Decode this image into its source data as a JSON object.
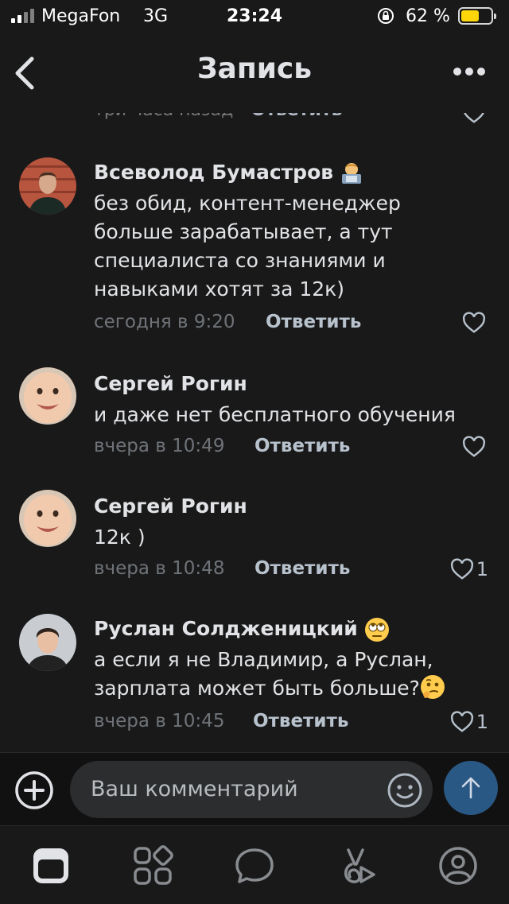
{
  "status_bar": {
    "carrier": "MegaFon",
    "network": "3G",
    "time": "23:24",
    "battery_percent": "62 %",
    "battery_level": 0.62
  },
  "header": {
    "title": "Запись",
    "back_icon": "chevron-left-icon",
    "more_icon": "more-horizontal-icon"
  },
  "previous_comment": {
    "meta": "три часа назад",
    "reply_label": "Ответить"
  },
  "comments": [
    {
      "author": "Всеволод Бумастров",
      "author_emoji": "technologist-emoji",
      "text": "без обид, контент-менеджер больше зарабатывает, а тут специалиста со знаниями и навыками хотят за 12к)",
      "time": "сегодня в 9:20",
      "reply_label": "Ответить",
      "likes": ""
    },
    {
      "author": "Сергей Рогин",
      "text": "и даже нет бесплатного обучения",
      "time": "вчера в 10:49",
      "reply_label": "Ответить",
      "likes": ""
    },
    {
      "author": "Сергей Рогин",
      "text": "12к )",
      "time": "вчера в 10:48",
      "reply_label": "Ответить",
      "likes": "1"
    },
    {
      "author": "Руслан Солдженицкий",
      "author_emoji": "rolling-eyes-emoji",
      "text": "а если я не Владимир, а Руслан, зарплата может быть больше?",
      "text_emoji": "thinking-face-emoji",
      "time": "вчера в 10:45",
      "reply_label": "Ответить",
      "likes": "1"
    }
  ],
  "composer": {
    "placeholder": "Ваш комментарий",
    "add_icon": "plus-circle-icon",
    "emoji_icon": "smile-icon",
    "send_icon": "arrow-up-icon"
  },
  "tab_bar": {
    "items": [
      "news-tab-icon",
      "services-tab-icon",
      "messages-tab-icon",
      "clips-tab-icon",
      "profile-tab-icon"
    ],
    "accent": "#2a5885"
  }
}
